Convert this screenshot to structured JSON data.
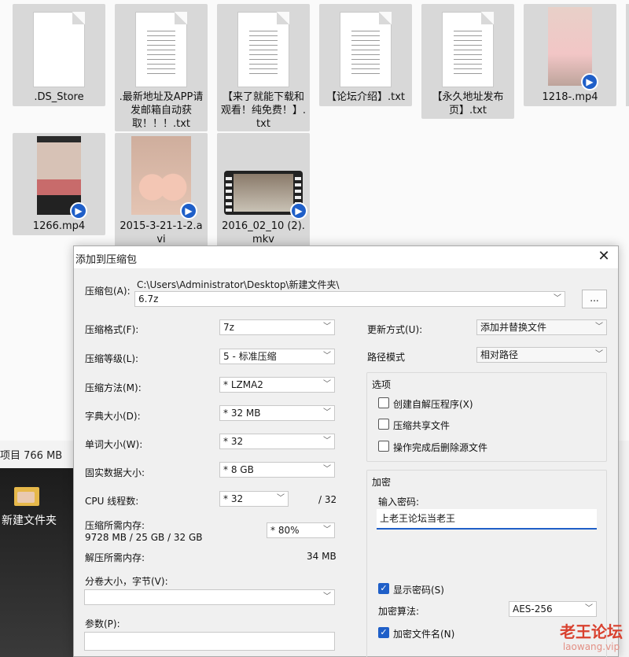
{
  "files": [
    {
      "name": ".DS_Store",
      "icon": "blank-document-icon"
    },
    {
      "name": ".最新地址及APP请发邮箱自动获取！！！.txt",
      "icon": "text-file-icon"
    },
    {
      "name": "【来了就能下载和观看！纯免费！】.txt",
      "icon": "text-file-icon"
    },
    {
      "name": "【论坛介绍】.txt",
      "icon": "text-file-icon"
    },
    {
      "name": "【永久地址发布页】.txt",
      "icon": "text-file-icon"
    },
    {
      "name": "1218-.mp4",
      "icon": "video-thumbnail-icon"
    },
    {
      "name": "1266.mp4",
      "icon": "video-thumbnail-icon"
    },
    {
      "name": "2015-3-21-1-2.avi",
      "icon": "video-thumbnail-icon"
    },
    {
      "name": "2016_02_10 (2).mkv",
      "icon": "film-strip-icon"
    }
  ],
  "status": {
    "items": "项目 766 MB"
  },
  "desktop": {
    "folder_label": "新建文件夹"
  },
  "dialog": {
    "title": "添加到压缩包",
    "archive_label": "压缩包(A):",
    "archive_path": "C:\\Users\\Administrator\\Desktop\\新建文件夹\\",
    "archive_name": "6.7z",
    "browse_label": "...",
    "format_label": "压缩格式(F):",
    "format_value": "7z",
    "level_label": "压缩等级(L):",
    "level_value": "5 - 标准压缩",
    "method_label": "压缩方法(M):",
    "method_value": "*  LZMA2",
    "dict_label": "字典大小(D):",
    "dict_value": "*  32 MB",
    "word_label": "单词大小(W):",
    "word_value": "*  32",
    "solid_label": "固实数据大小:",
    "solid_value": "*  8 GB",
    "cpu_label": "CPU 线程数:",
    "cpu_value": "*  32",
    "cpu_max": "/ 32",
    "mem_label": "压缩所需内存:",
    "mem_value": "9728 MB / 25 GB / 32 GB",
    "mem_pct": "*  80%",
    "decomp_label": "解压所需内存:",
    "decomp_value": "34 MB",
    "split_label": "分卷大小，字节(V):",
    "params_label": "参数(P):",
    "update_label": "更新方式(U):",
    "update_value": "添加并替换文件",
    "pathmode_label": "路径模式",
    "pathmode_value": "相对路径",
    "options_title": "选项",
    "opt_sfx": "创建自解压程序(X)",
    "opt_shared": "压缩共享文件",
    "opt_delete": "操作完成后删除源文件",
    "enc_title": "加密",
    "enc_pwd_label": "输入密码:",
    "enc_pwd_value": "上老王论坛当老王",
    "show_pwd": "显示密码(S)",
    "enc_method_label": "加密算法:",
    "enc_method_value": "AES-256",
    "enc_names": "加密文件名(N)"
  },
  "watermark": {
    "line1": "老王论坛",
    "line2": "laowang.vip"
  },
  "colors": {
    "accent": "#1f5fc8",
    "watermark": "#d9412f"
  }
}
